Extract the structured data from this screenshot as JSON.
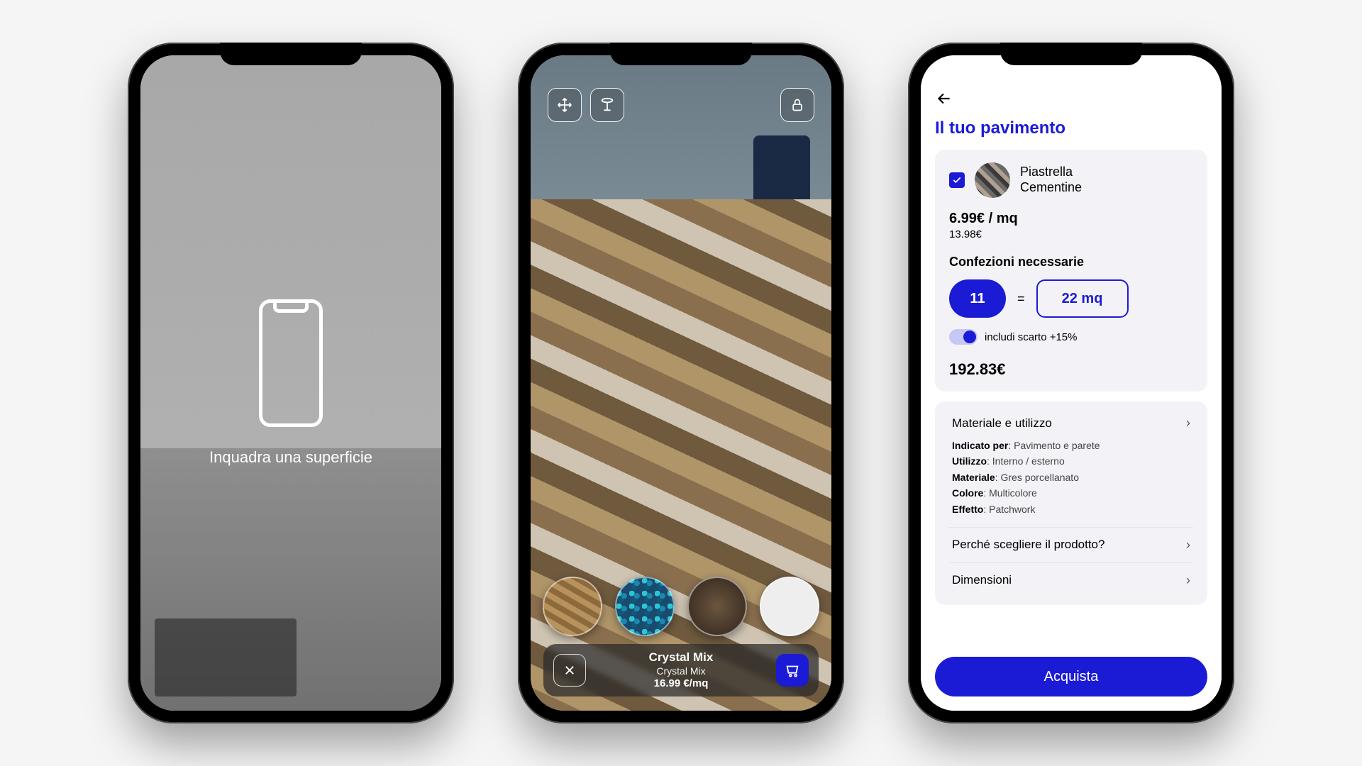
{
  "screen1": {
    "instruction": "Inquadra una superficie"
  },
  "screen2": {
    "tools": {
      "move": "move-icon",
      "height": "table-icon",
      "lock": "lock-icon"
    },
    "swatches": [
      "wood",
      "crystal",
      "dark-marble",
      "white"
    ],
    "product": {
      "name": "Crystal Mix",
      "subtitle": "Crystal Mix",
      "price": "16.99 €/mq"
    }
  },
  "screen3": {
    "title": "Il tuo pavimento",
    "product": {
      "name_line1": "Piastrella",
      "name_line2": "Cementine",
      "price_per_unit": "6.99€ / mq",
      "price_pack": "13.98€"
    },
    "packs": {
      "label": "Confezioni necessarie",
      "quantity": "11",
      "equals": "=",
      "area": "22 mq",
      "waste_toggle_label": "includi scarto +15%",
      "waste_toggle_on": true
    },
    "total": "192.83€",
    "sections": {
      "material": {
        "title": "Materiale e utilizzo",
        "rows": {
          "indicato_label": "Indicato per",
          "indicato_value": "Pavimento e parete",
          "utilizzo_label": "Utilizzo",
          "utilizzo_value": "Interno / esterno",
          "materiale_label": "Materiale",
          "materiale_value": "Gres porcellanato",
          "colore_label": "Colore",
          "colore_value": "Multicolore",
          "effetto_label": "Effetto",
          "effetto_value": "Patchwork"
        }
      },
      "perche": {
        "title": "Perché scegliere il prodotto?"
      },
      "dimensioni": {
        "title": "Dimensioni"
      }
    },
    "buy_label": "Acquista"
  }
}
